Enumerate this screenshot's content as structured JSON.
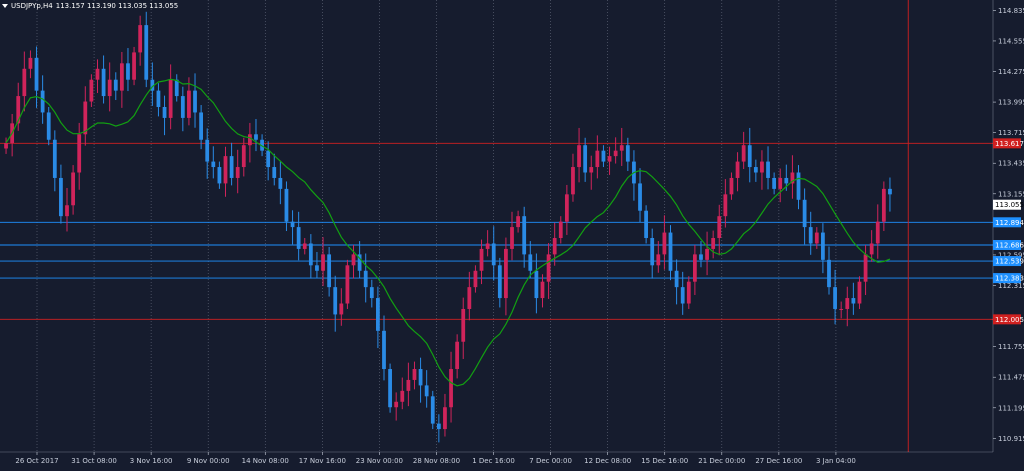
{
  "header": {
    "symbol": "USDJPYp,H4",
    "ohlc": "113.157 113.190 113.035 113.055"
  },
  "colors": {
    "background": "#161c2e",
    "grid": "#a8aec0",
    "bull": "#d0245b",
    "bear": "#2a8be6",
    "ma": "#12a012",
    "axis_text": "#c9cfdc",
    "resistance": "#d02020",
    "support": "#1e90ff",
    "current_price_bg": "#ffffff"
  },
  "chart_data": {
    "type": "candlestick",
    "series_name": "USDJPYp,H4",
    "ylim": [
      110.79,
      114.93
    ],
    "y_ticks": [
      "114.835",
      "114.555",
      "114.275",
      "113.995",
      "113.715",
      "113.435",
      "113.155",
      "112.595",
      "112.315",
      "111.755",
      "111.475",
      "111.195",
      "110.915"
    ],
    "x_labels": [
      "26 Oct 2017",
      "31 Oct 08:00",
      "3 Nov 16:00",
      "9 Nov 00:00",
      "14 Nov 08:00",
      "17 Nov 16:00",
      "23 Nov 00:00",
      "28 Nov 08:00",
      "1 Dec 16:00",
      "7 Dec 00:00",
      "12 Dec 08:00",
      "15 Dec 16:00",
      "21 Dec 00:00",
      "27 Dec 16:00",
      "3 Jan 04:00"
    ],
    "current_price": "113.055",
    "horizontal_levels": [
      {
        "price": 113.617,
        "label": "113.617",
        "kind": "resistance"
      },
      {
        "price": 112.894,
        "label": "112.894",
        "kind": "support"
      },
      {
        "price": 112.686,
        "label": "112.686",
        "kind": "support"
      },
      {
        "price": 112.539,
        "label": "112.539",
        "kind": "support"
      },
      {
        "price": 112.383,
        "label": "112.383",
        "kind": "support"
      },
      {
        "price": 112.005,
        "label": "112.005",
        "kind": "resistance"
      }
    ],
    "vertical_marker": {
      "kind": "resistance",
      "x_index": 148.5
    },
    "closes": [
      113.62,
      113.8,
      114.05,
      114.3,
      114.4,
      114.1,
      113.9,
      113.65,
      113.3,
      112.95,
      113.05,
      113.35,
      113.7,
      114.0,
      114.2,
      114.3,
      114.05,
      114.2,
      114.1,
      114.35,
      114.2,
      114.45,
      114.7,
      114.2,
      114.1,
      113.95,
      113.85,
      114.2,
      114.05,
      113.85,
      114.1,
      113.9,
      113.65,
      113.45,
      113.4,
      113.25,
      113.5,
      113.3,
      113.4,
      113.6,
      113.7,
      113.65,
      113.55,
      113.4,
      113.3,
      113.2,
      112.9,
      112.85,
      112.65,
      112.7,
      112.5,
      112.45,
      112.6,
      112.3,
      112.05,
      112.15,
      112.5,
      112.6,
      112.45,
      112.3,
      112.2,
      111.9,
      111.55,
      111.2,
      111.25,
      111.35,
      111.45,
      111.55,
      111.4,
      111.3,
      111.05,
      111.0,
      111.2,
      111.55,
      111.8,
      112.1,
      112.3,
      112.45,
      112.65,
      112.7,
      112.5,
      112.2,
      112.65,
      112.85,
      112.95,
      112.6,
      112.45,
      112.2,
      112.35,
      112.6,
      112.75,
      112.9,
      113.15,
      113.4,
      113.6,
      113.35,
      113.4,
      113.55,
      113.45,
      113.5,
      113.55,
      113.6,
      113.45,
      113.25,
      113.0,
      112.75,
      112.5,
      112.6,
      112.8,
      112.45,
      112.3,
      112.15,
      112.35,
      112.6,
      112.55,
      112.65,
      112.75,
      112.95,
      113.15,
      113.3,
      113.45,
      113.6,
      113.4,
      113.35,
      113.45,
      113.3,
      113.2,
      113.3,
      113.25,
      113.35,
      113.1,
      112.85,
      112.7,
      112.8,
      112.55,
      112.3,
      112.1,
      112.1,
      112.2,
      112.15,
      112.35,
      112.6,
      112.7,
      112.9,
      113.2,
      113.15
    ]
  }
}
